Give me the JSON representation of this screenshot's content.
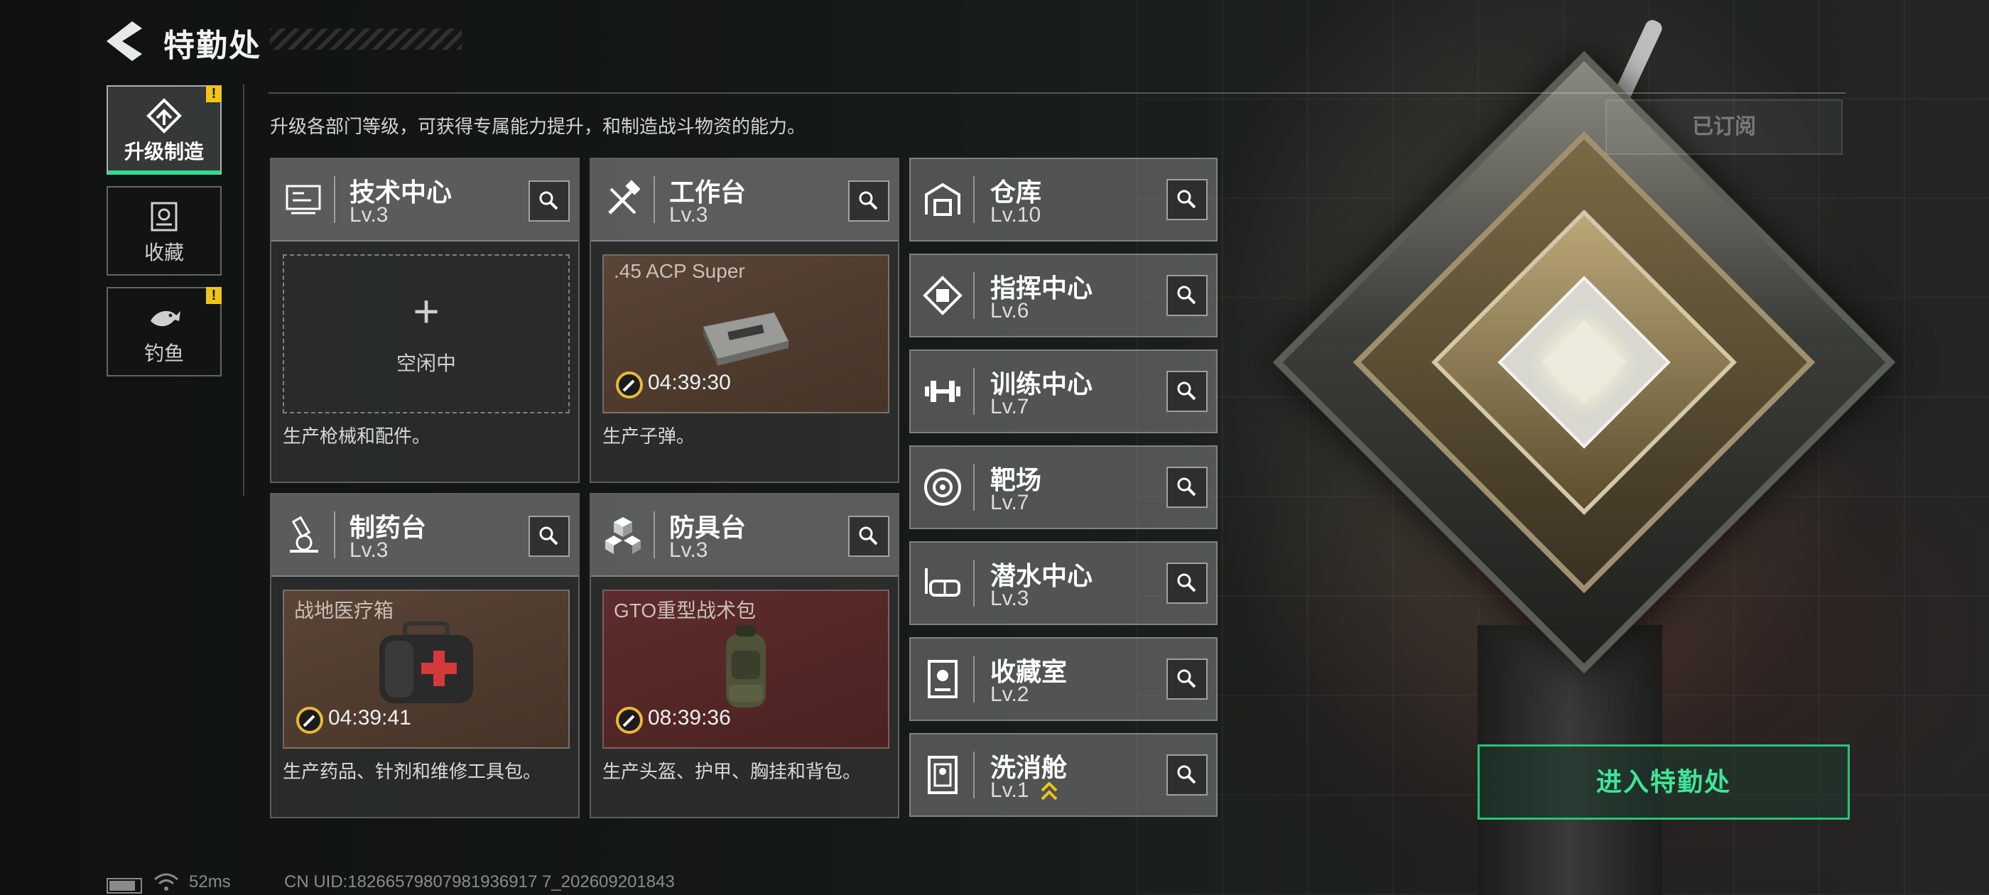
{
  "header": {
    "title": "特勤处"
  },
  "nav": [
    {
      "label": "升级制造",
      "icon": "upgrade-icon",
      "active": true,
      "badge": "!"
    },
    {
      "label": "收藏",
      "icon": "collection-icon",
      "active": false,
      "badge": ""
    },
    {
      "label": "钓鱼",
      "icon": "fish-icon",
      "active": false,
      "badge": "!"
    }
  ],
  "description": "升级各部门等级，可获得专属能力提升，和制造战斗物资的能力。",
  "subscribed_label": "已订阅",
  "cards": [
    {
      "name": "技术中心",
      "level": "Lv.3",
      "icon": "circuit-board-icon",
      "state": "idle",
      "idle_text": "空闲中",
      "plus": "+",
      "footer": "生产枪械和配件。"
    },
    {
      "name": "工作台",
      "level": "Lv.3",
      "icon": "tools-icon",
      "state": "producing",
      "item": ".45 ACP Super",
      "timer": "04:39:30",
      "footer": "生产子弹。"
    },
    {
      "name": "制药台",
      "level": "Lv.3",
      "icon": "microscope-icon",
      "state": "producing",
      "item": "战地医疗箱",
      "timer": "04:39:41",
      "footer": "生产药品、针剂和维修工具包。"
    },
    {
      "name": "防具台",
      "level": "Lv.3",
      "icon": "cubes-icon",
      "state": "producing",
      "item": "GTO重型战术包",
      "timer": "08:39:36",
      "footer": "生产头盔、护甲、胸挂和背包。"
    }
  ],
  "rows": [
    {
      "name": "仓库",
      "level": "Lv.10",
      "icon": "warehouse-icon"
    },
    {
      "name": "指挥中心",
      "level": "Lv.6",
      "icon": "chip-icon"
    },
    {
      "name": "训练中心",
      "level": "Lv.7",
      "icon": "dumbbell-icon"
    },
    {
      "name": "靶场",
      "level": "Lv.7",
      "icon": "target-icon"
    },
    {
      "name": "潜水中心",
      "level": "Lv.3",
      "icon": "diving-mask-icon"
    },
    {
      "name": "收藏室",
      "level": "Lv.2",
      "icon": "trophy-room-icon"
    },
    {
      "name": "洗消舱",
      "level": "Lv.1",
      "icon": "decontamination-icon",
      "upgradable": true
    }
  ],
  "enter_button": "进入特勤处",
  "status": {
    "ping": "52ms",
    "uid": "CN UID:18266579807981936917 7_202609201843"
  },
  "colors": {
    "accent": "#2fdc8c",
    "badge": "#f0c419",
    "enter": "#3ee699"
  }
}
